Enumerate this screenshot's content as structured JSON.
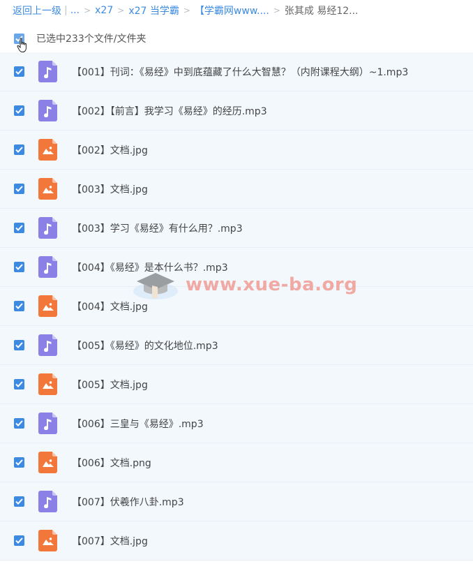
{
  "breadcrumb": {
    "back": "返回上一级",
    "ellipsis": "...",
    "items": [
      "x27",
      "x27 当学霸",
      "【学霸网www....",
      "张其成 易经12..."
    ]
  },
  "selection": {
    "text": "已选中233个文件/文件夹"
  },
  "files": [
    {
      "name": "【001】刊词：《易经》中到底蕴藏了什么大智慧？（内附课程大纲）~1.mp3",
      "type": "audio"
    },
    {
      "name": "【002】【前言】我学习《易经》的经历.mp3",
      "type": "audio"
    },
    {
      "name": "【002】文档.jpg",
      "type": "image"
    },
    {
      "name": "【003】文档.jpg",
      "type": "image"
    },
    {
      "name": "【003】学习《易经》有什么用？.mp3",
      "type": "audio"
    },
    {
      "name": "【004】《易经》是本什么书？.mp3",
      "type": "audio"
    },
    {
      "name": "【004】文档.jpg",
      "type": "image"
    },
    {
      "name": "【005】《易经》的文化地位.mp3",
      "type": "audio"
    },
    {
      "name": "【005】文档.jpg",
      "type": "image"
    },
    {
      "name": "【006】三皇与《易经》.mp3",
      "type": "audio"
    },
    {
      "name": "【006】文档.png",
      "type": "image"
    },
    {
      "name": "【007】伏羲作八卦.mp3",
      "type": "audio"
    },
    {
      "name": "【007】文档.jpg",
      "type": "image"
    }
  ],
  "watermark": {
    "text": "www.xue-ba.org"
  },
  "colors": {
    "accent": "#3d8be0",
    "audio": "#8b80e6",
    "image": "#f2773b"
  }
}
